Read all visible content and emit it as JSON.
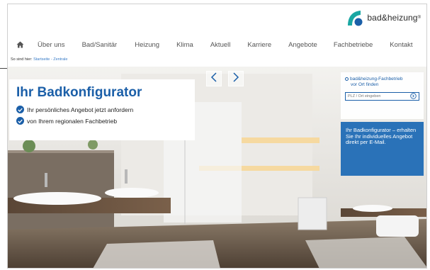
{
  "brand": {
    "name": "bad&heizung",
    "mark": "®",
    "accent": "#1b5fa8",
    "logo_teal": "#1aa7a3"
  },
  "nav": {
    "home_icon": "home-icon",
    "items": [
      "Über uns",
      "Bad/Sanitär",
      "Heizung",
      "Klima",
      "Aktuell",
      "Karriere",
      "Angebote",
      "Fachbetriebe",
      "Kontakt"
    ]
  },
  "breadcrumb": {
    "label": "So sind hier:",
    "path": "Startseite - Zentrale"
  },
  "hero": {
    "title": "Ihr Badkonfigurator",
    "bullets": [
      "Ihr persönliches Angebot jetzt anfordern",
      "von Ihrem regionalen Fachbetrieb"
    ],
    "prev_icon": "chevron-left-icon",
    "next_icon": "chevron-right-icon"
  },
  "finder": {
    "title_line1": "bad&heizung-Fachbetrieb",
    "title_line2": "vor Ort finden",
    "search_placeholder": "PLZ / Ort eingeben",
    "search_icon": "arrow-circle-icon"
  },
  "promo": {
    "text": "Ihr Badkonfigurator – erhalten Sie Ihr individuelles Angebot direkt per E-Mail."
  }
}
